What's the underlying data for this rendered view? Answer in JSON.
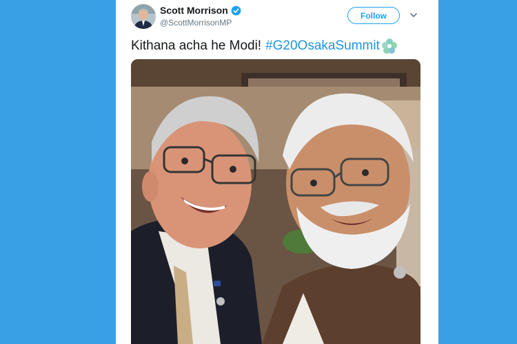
{
  "tweet": {
    "author_name": "Scott Morrison",
    "author_handle": "@ScottMorrisonMP",
    "follow_label": "Follow",
    "text": "Kithana acha he Modi!",
    "hashtag": "#G20OsakaSummit"
  },
  "icons": {
    "verified": "verified-badge-icon",
    "more": "chevron-down-icon",
    "emoji": "g20-flower-emoji-icon"
  },
  "colors": {
    "page_background": "#3aa0e6",
    "accent": "#1da1f2",
    "hashtag": "#1b95e0"
  }
}
